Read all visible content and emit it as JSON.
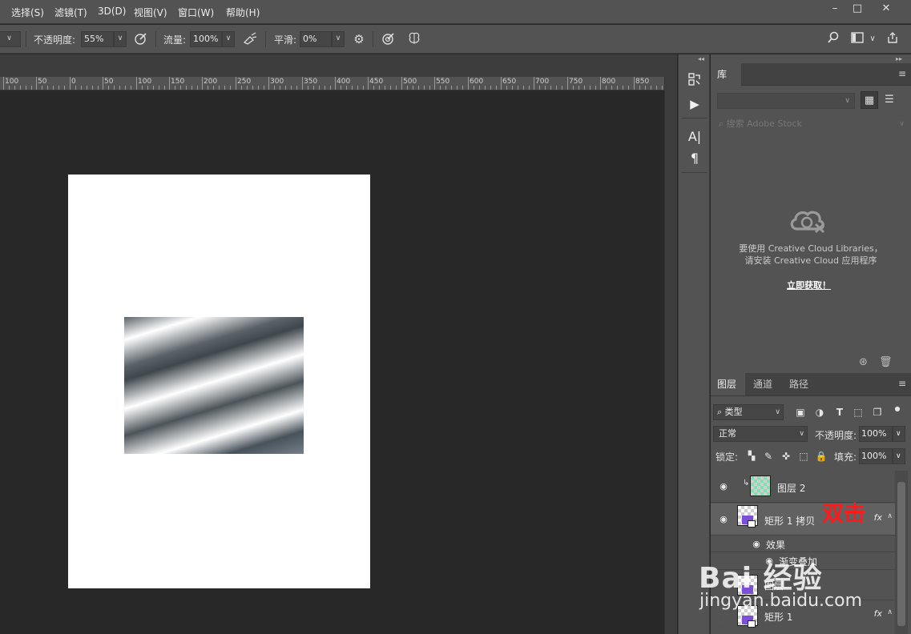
{
  "menubar": {
    "items": [
      "选择(S)",
      "滤镜(T)",
      "3D(D)",
      "视图(V)",
      "窗口(W)",
      "帮助(H)"
    ]
  },
  "window_controls": {
    "minimize_icon": "minimize-icon",
    "restore_icon": "restore-icon",
    "close_icon": "close-icon"
  },
  "options_bar": {
    "opacity_label": "不透明度:",
    "opacity_value": "55%",
    "flow_label": "流量:",
    "flow_value": "100%",
    "smoothing_label": "平滑:",
    "smoothing_value": "0%"
  },
  "ruler": {
    "labels": [
      "100",
      "50",
      "0",
      "50",
      "100",
      "150",
      "200",
      "250",
      "300",
      "350",
      "400",
      "450",
      "500",
      "550",
      "600",
      "650",
      "700",
      "750",
      "800",
      "850"
    ]
  },
  "tool_column": {
    "icons": [
      "history-icon",
      "play-icon",
      "character-icon",
      "paragraph-icon"
    ]
  },
  "libraries": {
    "tab": "库",
    "search_placeholder": "搜索 Adobe Stock",
    "message_line1": "要使用 Creative Cloud Libraries，",
    "message_line2": "请安装 Creative Cloud 应用程序",
    "link": "立即获取！"
  },
  "layers_panel": {
    "tabs": [
      "图层",
      "通道",
      "路径"
    ],
    "filter_type": "类型",
    "blend_mode": "正常",
    "opacity_label": "不透明度:",
    "opacity_value": "100%",
    "lock_label": "锁定:",
    "fill_label": "填充:",
    "fill_value": "100%",
    "layers": [
      {
        "name": "图层 2",
        "visible": true,
        "selected": false,
        "fx": false
      },
      {
        "name": "矩形 1 拷贝",
        "visible": true,
        "selected": true,
        "fx": true,
        "fx_label": "fx"
      },
      {
        "name": "效果",
        "visible": true,
        "sub": true
      },
      {
        "name": "渐变叠加",
        "visible": true,
        "sub": true
      },
      {
        "name": "图层",
        "visible": false
      },
      {
        "name": "矩形 1",
        "visible": false,
        "fx": true,
        "fx_label": "fx"
      }
    ]
  },
  "annotation": "双击",
  "watermark": {
    "line1": "Bai 经验",
    "line2": "jingyan.baidu.com"
  },
  "colors": {
    "panel": "#535353",
    "canvas_bg": "#282828",
    "annotation": "#ff1a1a",
    "thumb_green": "#7fe0b0",
    "thumb_purple": "#7b4fd6"
  }
}
